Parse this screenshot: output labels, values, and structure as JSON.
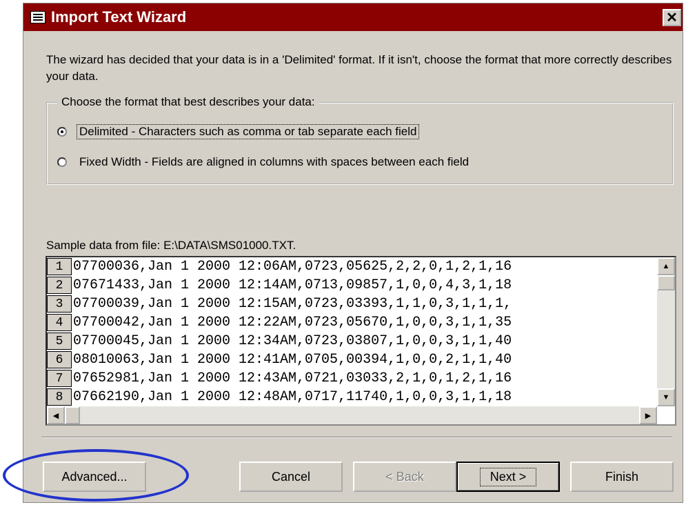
{
  "window": {
    "title": "Import Text Wizard",
    "close_glyph": "✕"
  },
  "description": "The wizard has decided that your data is in a 'Delimited' format.  If it isn't, choose the format that more correctly describes your data.",
  "format_group": {
    "legend": "Choose the format that best describes your data:",
    "options": [
      {
        "label": "Delimited - Characters such as comma or tab separate each field",
        "selected": true
      },
      {
        "label": "Fixed Width - Fields are aligned in columns with spaces between each field",
        "selected": false
      }
    ]
  },
  "sample": {
    "label": "Sample data from file: E:\\DATA\\SMS01000.TXT.",
    "rows": [
      {
        "num": "1",
        "text": "07700036,Jan 1 2000 12:06AM,0723,05625,2,2,0,1,2,1,16"
      },
      {
        "num": "2",
        "text": "07671433,Jan 1 2000 12:14AM,0713,09857,1,0,0,4,3,1,18"
      },
      {
        "num": "3",
        "text": "07700039,Jan 1 2000 12:15AM,0723,03393,1,1,0,3,1,1,1,"
      },
      {
        "num": "4",
        "text": "07700042,Jan 1 2000 12:22AM,0723,05670,1,0,0,3,1,1,35"
      },
      {
        "num": "5",
        "text": "07700045,Jan 1 2000 12:34AM,0723,03807,1,0,0,3,1,1,40"
      },
      {
        "num": "6",
        "text": "08010063,Jan 1 2000 12:41AM,0705,00394,1,0,0,2,1,1,40"
      },
      {
        "num": "7",
        "text": "07652981,Jan 1 2000 12:43AM,0721,03033,2,1,0,1,2,1,16"
      },
      {
        "num": "8",
        "text": "07662190,Jan 1 2000 12:48AM,0717,11740,1,0,0,3,1,1,18"
      }
    ]
  },
  "buttons": {
    "advanced": "Advanced...",
    "cancel": "Cancel",
    "back": "< Back",
    "next": "Next >",
    "finish": "Finish"
  },
  "colors": {
    "title_bar": "#8b0000",
    "dialog_bg": "#d4d0c8",
    "highlight_oval": "#2233cc"
  }
}
